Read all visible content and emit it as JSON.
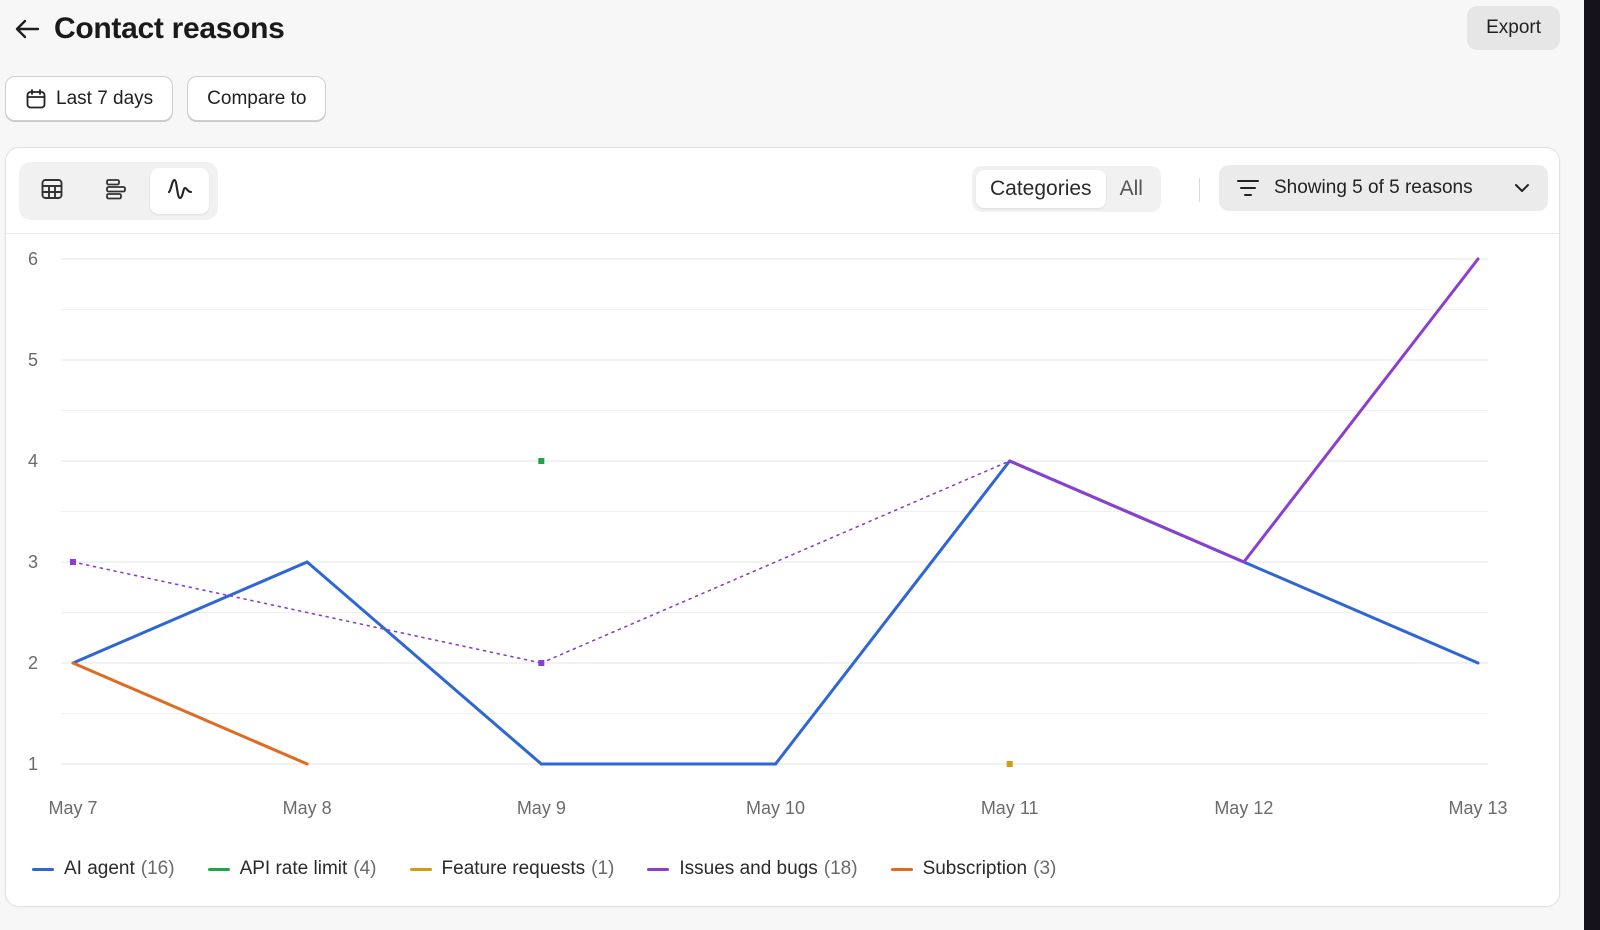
{
  "header": {
    "title": "Contact reasons",
    "export_label": "Export"
  },
  "filters": {
    "date_range_label": "Last 7 days",
    "compare_label": "Compare to"
  },
  "toolbar": {
    "view_icons": [
      "table-icon",
      "bar-list-icon",
      "line-chart-icon"
    ],
    "active_view": "line-chart",
    "segment": {
      "categories_label": "Categories",
      "all_label": "All",
      "active": "Categories"
    },
    "reasons_label": "Showing 5 of 5 reasons"
  },
  "legend": [
    {
      "name": "AI agent",
      "count": "(16)",
      "color": "#2f66d6"
    },
    {
      "name": "API rate limit",
      "count": "(4)",
      "color": "#21a34a"
    },
    {
      "name": "Feature requests",
      "count": "(1)",
      "color": "#d49b14"
    },
    {
      "name": "Issues and bugs",
      "count": "(18)",
      "color": "#8a3fd1"
    },
    {
      "name": "Subscription",
      "count": "(3)",
      "color": "#e06a1f"
    }
  ],
  "chart_data": {
    "type": "line",
    "categories": [
      "May 7",
      "May 8",
      "May 9",
      "May 10",
      "May 11",
      "May 12",
      "May 13"
    ],
    "ylim": [
      1,
      6
    ],
    "yticks": [
      1,
      2,
      3,
      4,
      5,
      6
    ],
    "grid": true,
    "legend_position": "bottom-left",
    "series": [
      {
        "name": "AI agent",
        "color": "#2f66d6",
        "values": [
          2,
          3,
          1,
          1,
          4,
          3,
          2
        ]
      },
      {
        "name": "API rate limit",
        "color": "#21a34a",
        "values": [
          null,
          null,
          4,
          null,
          null,
          null,
          null
        ]
      },
      {
        "name": "Feature requests",
        "color": "#d49b14",
        "values": [
          null,
          null,
          null,
          null,
          1,
          null,
          null
        ]
      },
      {
        "name": "Issues and bugs",
        "color": "#8a3fd1",
        "values": [
          3,
          null,
          2,
          null,
          4,
          3,
          6
        ]
      },
      {
        "name": "Subscription",
        "color": "#e06a1f",
        "values": [
          2,
          1,
          null,
          null,
          null,
          null,
          null
        ]
      }
    ]
  }
}
